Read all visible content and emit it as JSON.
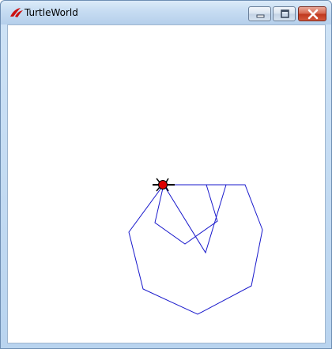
{
  "window": {
    "title": "TurtleWorld",
    "controls": {
      "minimize": "minimize",
      "maximize": "maximize",
      "close": "close"
    }
  },
  "canvas": {
    "path_color": "#1a1acc",
    "turtle_color": "#dd0000",
    "turtle_outline": "#000000"
  },
  "icons": {
    "app": "tk-feather-icon",
    "minimize": "minimize-icon",
    "maximize": "maximize-icon",
    "close": "close-icon"
  }
}
